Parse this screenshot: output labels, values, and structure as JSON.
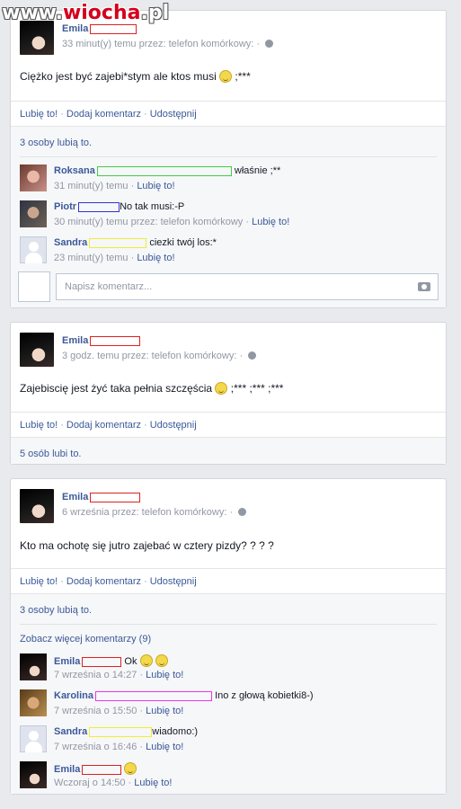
{
  "watermark": {
    "prefix": "www.",
    "mid": "wiocha",
    "suffix": ".pl"
  },
  "actions": {
    "like": "Lubię to!",
    "comment": "Dodaj komentarz",
    "share": "Udostępnij"
  },
  "compose_placeholder": "Napisz komentarz...",
  "post1": {
    "author": "Emila",
    "meta": "33 minut(y) temu przez: telefon komórkowy: ·",
    "text": "Ciężko jest być zajebi*stym ale ktos musi",
    "text_tail": " ;***",
    "likes": "3 osoby lubią to.",
    "comments": [
      {
        "name": "Roksana",
        "text": "właśnie ;**",
        "meta": "31 minut(y) temu · ",
        "like": "Lubię to!",
        "redact_color": "#44cc44"
      },
      {
        "name": "Piotr",
        "text": "No tak musi:-P",
        "meta": "30 minut(y) temu przez: telefon komórkowy · ",
        "like": "Lubię to!",
        "redact_color": "#3333cc"
      },
      {
        "name": "Sandra",
        "text": "ciezki twój los:*",
        "meta": "23 minut(y) temu · ",
        "like": "Lubię to!",
        "redact_color": "#eeee33"
      }
    ]
  },
  "post2": {
    "author": "Emila",
    "meta": "3 godz. temu przez: telefon komórkowy: ·",
    "text": "Zajebiscię jest żyć taka pełnia szczęścia",
    "text_tail": " ;*** ;*** ;***",
    "likes": "5 osób lubi to."
  },
  "post3": {
    "author": "Emila",
    "meta": "6 września przez: telefon komórkowy: ·",
    "text": "Kto ma ochotę się jutro zajebać w cztery pizdy? ? ? ?",
    "likes": "3 osoby lubią to.",
    "more_comments": "Zobacz więcej komentarzy (9)",
    "comments": [
      {
        "name": "Emila",
        "text": "Ok",
        "meta": "7 września o 14:27 · ",
        "like": "Lubię to!",
        "redact_color": "#dd2222"
      },
      {
        "name": "Karolina",
        "text": "Ino z głową kobietki8-)",
        "meta": "7 września o 15:50 · ",
        "like": "Lubię to!",
        "redact_color": "#ee33ee"
      },
      {
        "name": "Sandra",
        "text": "wiadomo:)",
        "meta": "7 września o 16:46 · ",
        "like": "Lubię to!",
        "redact_color": "#eeee33"
      },
      {
        "name": "Emila",
        "text": "",
        "meta": "Wczoraj o 14:50 · ",
        "like": "Lubię to!",
        "redact_color": "#dd2222"
      }
    ]
  }
}
